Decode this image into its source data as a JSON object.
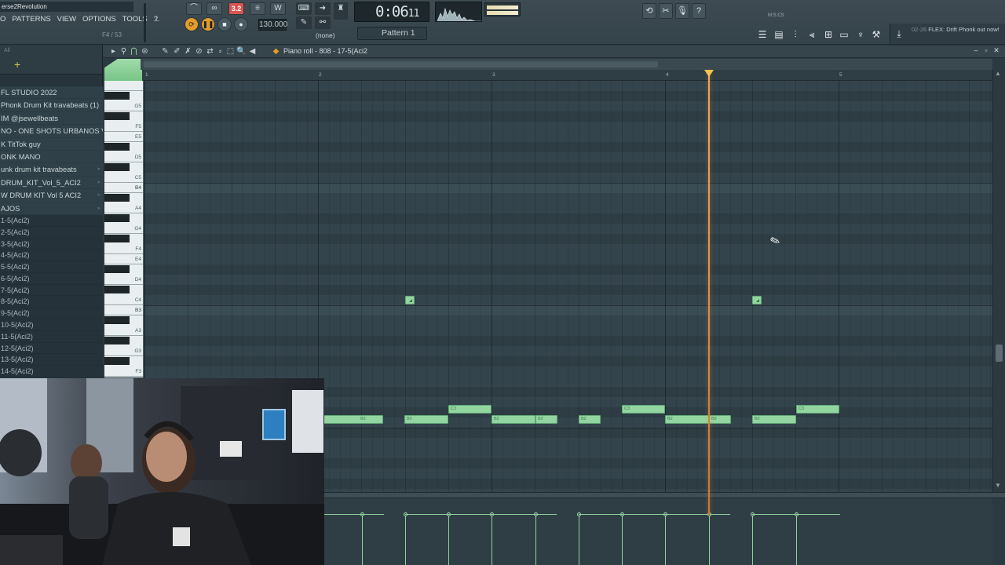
{
  "window": {
    "project_title": "erse2Revolution"
  },
  "menu": [
    "O",
    "PATTERNS",
    "VIEW",
    "OPTIONS",
    "TOOLS",
    "?"
  ],
  "hint": "F4 / 53",
  "transport": {
    "time": "0:06",
    "time_small": "11",
    "time_unit": "M:S:CS",
    "tempo": "130.000",
    "snap_label": "3.2",
    "pattern_none": "(none)",
    "pattern": "Pattern 1"
  },
  "news": {
    "date": "02-26",
    "text": "FLEX: Drift Phonk out now!"
  },
  "browser": {
    "filter": "All",
    "items": [
      {
        "label": "FL STUDIO 2022",
        "type": "folder"
      },
      {
        "label": "Phonk Drum Kit travabeats (1)",
        "type": "folder"
      },
      {
        "label": "IM @jsewellbeats",
        "type": "folder"
      },
      {
        "label": "NO - ONE SHOTS URBANOS VOL. 2",
        "type": "folder"
      },
      {
        "label": "K TitTok guy",
        "type": "folder"
      },
      {
        "label": "ONK MANO",
        "type": "folder"
      },
      {
        "label": "unk drum kit travabeats",
        "type": "folder"
      },
      {
        "label": "DRUM_KIT_Vol_5_ACI2",
        "type": "folder"
      },
      {
        "label": "W DRUM KIT Vol 5 ACI2",
        "type": "folder"
      },
      {
        "label": "AJOS",
        "type": "folder"
      },
      {
        "label": "1-5(Aci2)",
        "type": "sample"
      },
      {
        "label": "2-5(Aci2)",
        "type": "sample"
      },
      {
        "label": "3-5(Aci2)",
        "type": "sample"
      },
      {
        "label": "4-5(Aci2)",
        "type": "sample"
      },
      {
        "label": "5-5(Aci2)",
        "type": "sample"
      },
      {
        "label": "6-5(Aci2)",
        "type": "sample"
      },
      {
        "label": "7-5(Aci2)",
        "type": "sample"
      },
      {
        "label": "8-5(Aci2)",
        "type": "sample"
      },
      {
        "label": "9-5(Aci2)",
        "type": "sample"
      },
      {
        "label": "10-5(Aci2)",
        "type": "sample"
      },
      {
        "label": "11-5(Aci2)",
        "type": "sample"
      },
      {
        "label": "12-5(Aci2)",
        "type": "sample"
      },
      {
        "label": "13-5(Aci2)",
        "type": "sample"
      },
      {
        "label": "14-5(Aci2)",
        "type": "sample"
      }
    ]
  },
  "piano_roll": {
    "title": "Piano roll - 808 - 17-5(Aci2",
    "bars": [
      "1",
      "2",
      "3",
      "4",
      "5"
    ],
    "key_labels": [
      "G5",
      "F5",
      "E5",
      "D5",
      "C5",
      "B4",
      "A4",
      "G4",
      "F4",
      "E4",
      "D4",
      "C4",
      "B3",
      "A3",
      "G3",
      "F3",
      "E3"
    ],
    "notes": [
      {
        "label": "",
        "pitch": "B3"
      },
      {
        "label": "",
        "pitch": "B3"
      },
      {
        "label": "B2",
        "pitch": "B2"
      },
      {
        "label": "B2",
        "pitch": "B2"
      },
      {
        "label": "C3",
        "pitch": "C3"
      },
      {
        "label": "B2",
        "pitch": "B2"
      },
      {
        "label": "B2",
        "pitch": "B2"
      },
      {
        "label": "B2",
        "pitch": "B2"
      },
      {
        "label": "C3",
        "pitch": "C3"
      },
      {
        "label": "B2",
        "pitch": "B2"
      },
      {
        "label": "B2",
        "pitch": "B2"
      },
      {
        "label": "B2",
        "pitch": "B2"
      },
      {
        "label": "C3",
        "pitch": "C3"
      }
    ]
  },
  "colors": {
    "note": "#93d5a0",
    "playhead": "#f0a85a",
    "accent": "#e39c2a"
  }
}
